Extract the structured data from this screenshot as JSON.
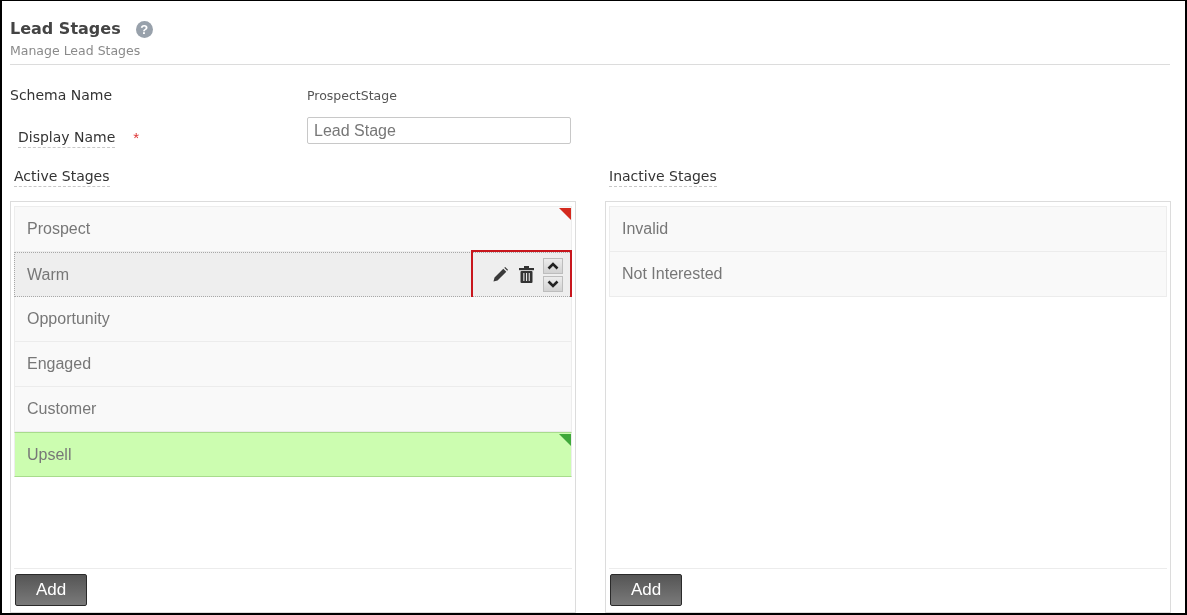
{
  "header": {
    "title": "Lead Stages",
    "help_icon": "?",
    "subtitle": "Manage Lead Stages"
  },
  "fields": [
    {
      "kind": "static",
      "label": "Schema Name",
      "value": "ProspectStage"
    },
    {
      "kind": "input",
      "label": "Display Name",
      "required_mark": "*",
      "value": "Lead Stage"
    }
  ],
  "panels": [
    {
      "title": "Active Stages",
      "stages": [
        {
          "name": "Prospect",
          "hovered": false,
          "highlighted": false,
          "color": "#d42a1e"
        },
        {
          "name": "Warm",
          "hovered": true,
          "highlighted": false
        },
        {
          "name": "Opportunity",
          "hovered": false,
          "highlighted": false
        },
        {
          "name": "Engaged",
          "hovered": false,
          "highlighted": false
        },
        {
          "name": "Customer",
          "hovered": false,
          "highlighted": false
        },
        {
          "name": "Upsell",
          "hovered": false,
          "highlighted": true,
          "color": "#3fa83a"
        }
      ],
      "add_button": "Add"
    },
    {
      "title": "Inactive Stages",
      "stages": [
        {
          "name": "Invalid",
          "hovered": false,
          "highlighted": false
        },
        {
          "name": "Not Interested",
          "hovered": false,
          "highlighted": false
        }
      ],
      "add_button": "Add"
    }
  ]
}
